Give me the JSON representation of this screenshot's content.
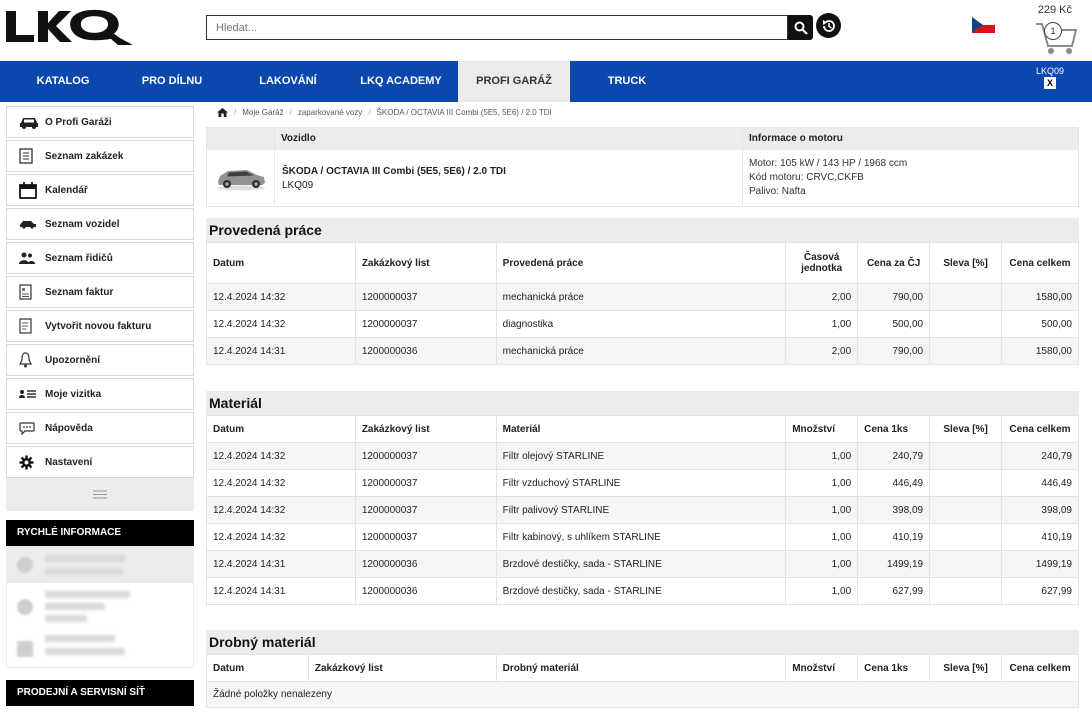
{
  "header": {
    "logo_text": "LKQ",
    "search_placeholder": "Hledat...",
    "cart_price": "229 Kč",
    "cart_count": "1"
  },
  "nav": {
    "items": [
      {
        "label": "KATALOG"
      },
      {
        "label": "PRO DÍLNU"
      },
      {
        "label": "LAKOVÁNÍ"
      },
      {
        "label": "LKQ ACADEMY"
      },
      {
        "label": "PROFI GARÁŽ"
      },
      {
        "label": "TRUCK"
      }
    ],
    "active": "PROFI GARÁŽ",
    "user_code": "LKQ09",
    "user_close": "X"
  },
  "sidebar": {
    "items": [
      {
        "label": "O Profi Garáži",
        "icon": "car-icon"
      },
      {
        "label": "Seznam zakázek",
        "icon": "list-icon"
      },
      {
        "label": "Kalendář",
        "icon": "calendar-icon"
      },
      {
        "label": "Seznam vozidel",
        "icon": "car-side-icon"
      },
      {
        "label": "Seznam řidičů",
        "icon": "users-icon"
      },
      {
        "label": "Seznam faktur",
        "icon": "invoice-icon"
      },
      {
        "label": "Vytvořit novou fakturu",
        "icon": "new-invoice-icon"
      },
      {
        "label": "Upozornění",
        "icon": "bell-icon"
      },
      {
        "label": "Moje vizitka",
        "icon": "card-icon"
      },
      {
        "label": "Nápověda",
        "icon": "help-icon"
      },
      {
        "label": "Nastavení",
        "icon": "gear-icon"
      }
    ],
    "quick_info_title": "RYCHLÉ INFORMACE",
    "network_title": "PRODEJNÍ A SERVISNÍ SÍŤ"
  },
  "breadcrumb": {
    "items": [
      "Moje Garáž",
      "zaparkované vozy",
      "ŠKODA / OCTAVIA III Combi (5E5, 5E6) / 2.0 TDI"
    ]
  },
  "vehicle": {
    "head_vehicle": "Vozidlo",
    "head_engine": "Informace o motoru",
    "name": "ŠKODA / OCTAVIA III Combi (5E5, 5E6) / 2.0 TDI",
    "code": "LKQ09",
    "engine_lines": [
      "Motor: 105 kW / 143 HP / 1968 ccm",
      "Kód motoru: CRVC,CKFB",
      "Palivo: Nafta"
    ]
  },
  "work": {
    "title": "Provedená práce",
    "headers": [
      "Datum",
      "Zakázkový list",
      "Provedená práce",
      "Časová jednotka",
      "Cena za ČJ",
      "Sleva [%]",
      "Cena celkem"
    ],
    "rows": [
      [
        "12.4.2024 14:32",
        "1200000037",
        "mechanická práce",
        "2,00",
        "790,00",
        "",
        "1580,00"
      ],
      [
        "12.4.2024 14:32",
        "1200000037",
        "diagnostika",
        "1,00",
        "500,00",
        "",
        "500,00"
      ],
      [
        "12.4.2024 14:31",
        "1200000036",
        "mechanická práce",
        "2,00",
        "790,00",
        "",
        "1580,00"
      ]
    ]
  },
  "material": {
    "title": "Materiál",
    "headers": [
      "Datum",
      "Zakázkový list",
      "Materiál",
      "Množství",
      "Cena 1ks",
      "Sleva [%]",
      "Cena celkem"
    ],
    "rows": [
      [
        "12.4.2024 14:32",
        "1200000037",
        "Filtr olejový STARLINE",
        "1,00",
        "240,79",
        "",
        "240,79"
      ],
      [
        "12.4.2024 14:32",
        "1200000037",
        "Filtr vzduchový STARLINE",
        "1,00",
        "446,49",
        "",
        "446,49"
      ],
      [
        "12.4.2024 14:32",
        "1200000037",
        "Filtr palivový STARLINE",
        "1,00",
        "398,09",
        "",
        "398,09"
      ],
      [
        "12.4.2024 14:32",
        "1200000037",
        "Filtr kabinový, s uhlíkem STARLINE",
        "1,00",
        "410,19",
        "",
        "410,19"
      ],
      [
        "12.4.2024 14:31",
        "1200000036",
        "Brzdové destičky, sada - STARLINE",
        "1,00",
        "1499,19",
        "",
        "1499,19"
      ],
      [
        "12.4.2024 14:31",
        "1200000036",
        "Brzdové destičky, sada - STARLINE",
        "1,00",
        "627,99",
        "",
        "627,99"
      ]
    ]
  },
  "small_material": {
    "title": "Drobný materiál",
    "headers": [
      "Datum",
      "Zakázkový list",
      "Drobný materiál",
      "Množství",
      "Cena 1ks",
      "Sleva [%]",
      "Cena celkem"
    ],
    "empty_text": "Žádné položky nenalezeny"
  },
  "colors": {
    "brand_blue": "#0b48ad",
    "black": "#000000",
    "section_gray": "#ececec"
  }
}
